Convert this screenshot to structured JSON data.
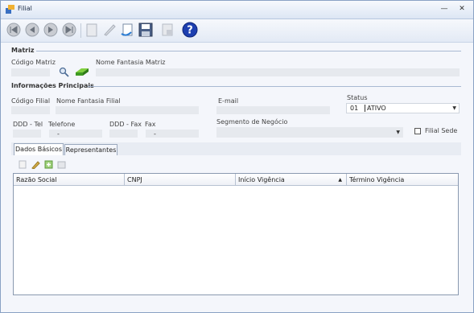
{
  "window": {
    "title": "Filial"
  },
  "toolbar": {
    "buttons": [
      "first-icon",
      "previous-icon",
      "play-icon",
      "last-icon",
      "new-icon",
      "edit-icon",
      "undo-icon",
      "save-icon",
      "lock-icon",
      "help-icon"
    ]
  },
  "matriz": {
    "section_title": "Matriz",
    "codigo_label": "Código Matriz",
    "fantasia_label": "Nome Fantasia Matriz"
  },
  "info": {
    "section_title": "Informações Principais",
    "codigo_filial_label": "Código Filial",
    "fantasia_filial_label": "Nome Fantasia Filial",
    "email_label": "E-mail",
    "status_label": "Status",
    "status_code": "01",
    "status_value": "ATIVO",
    "ddd_tel_label": "DDD - Tel",
    "telefone_label": "Telefone",
    "telefone_value": "-",
    "ddd_fax_label": "DDD - Fax",
    "fax_label": "Fax",
    "fax_value": "-",
    "segmento_label": "Segmento de Negócio",
    "filial_sede_label": "Filial Sede"
  },
  "tabs": [
    {
      "label": "Dados Básicos"
    },
    {
      "label": "Representantes"
    }
  ],
  "grid": {
    "columns": [
      "Razão Social",
      "CNPJ",
      "Início Vigência",
      "Término Vigência"
    ],
    "sort_indicator": "▲"
  }
}
